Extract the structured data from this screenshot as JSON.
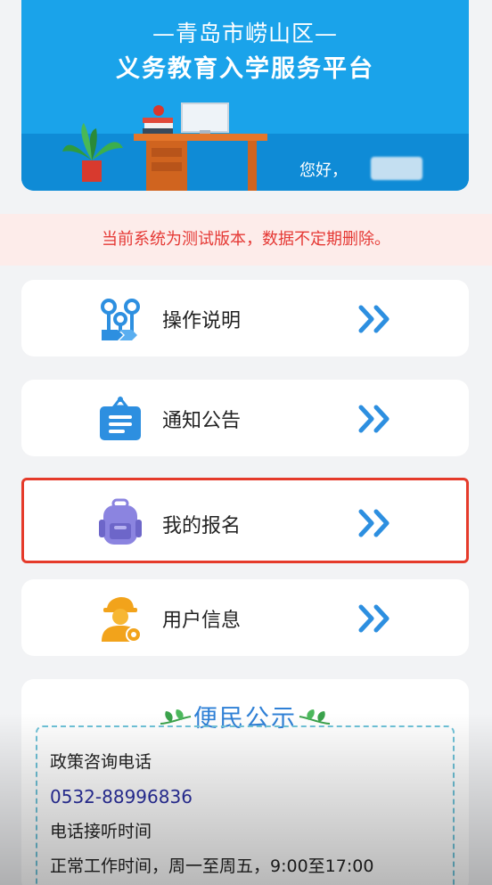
{
  "banner": {
    "subtitle": "—青岛市崂山区—",
    "title": "义务教育入学服务平台",
    "greeting": "您好，"
  },
  "notice": {
    "text": "当前系统为测试版本，数据不定期删除。"
  },
  "menu": [
    {
      "label": "操作说明",
      "icon": "flow-steps-icon"
    },
    {
      "label": "通知公告",
      "icon": "notice-board-icon"
    },
    {
      "label": "我的报名",
      "icon": "backpack-icon"
    },
    {
      "label": "用户信息",
      "icon": "user-id-icon"
    }
  ],
  "info": {
    "title": "便民公示",
    "lines": [
      "政策咨询电话",
      "0532-88996836",
      "电话接听时间",
      "正常工作时间，周一至周五，9:00至17:00"
    ]
  },
  "colors": {
    "banner": "#1aa3ea",
    "notice_text": "#e53935",
    "highlight_border": "#e53a2a",
    "arrow": "#2d8fe0",
    "info_title": "#2f80d6"
  }
}
